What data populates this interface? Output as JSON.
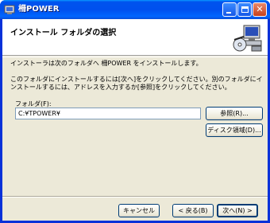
{
  "window": {
    "title": "柵POWER",
    "colors": {
      "titlebar": "#0054e3",
      "face": "#ece9d8",
      "header_bg": "#ffffff"
    }
  },
  "header": {
    "title": "インストール フォルダの選択",
    "graphic": "computer-install-icon"
  },
  "body": {
    "description1": "インストーラは次のフォルダへ 柵POWER をインストールします。",
    "description2": "このフォルダにインストールするには[次へ]をクリックしてください。別のフォルダにインストールするには、アドレスを入力するか[参照]をクリックしてください。",
    "folder_label": "フォルダ(F):",
    "folder_value": "C:¥TPOWER¥",
    "browse_label": "参照(R)...",
    "disk_label": "ディスク領域(D)..."
  },
  "footer": {
    "cancel_label": "キャンセル",
    "back_label": "< 戻る(B)",
    "next_label": "次へ(N) >"
  }
}
